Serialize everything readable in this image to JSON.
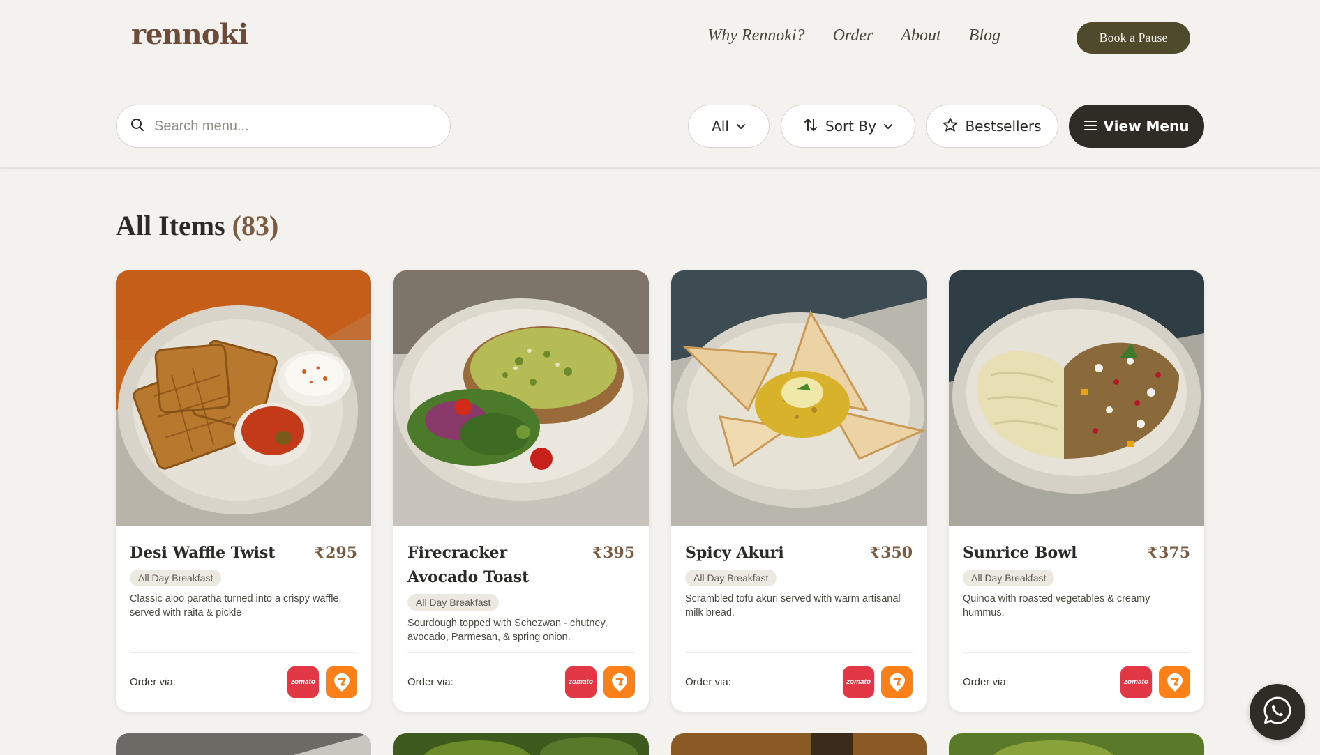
{
  "brand": {
    "logo_text": "rennoki"
  },
  "nav": {
    "items": [
      {
        "label": "Why Rennoki?"
      },
      {
        "label": "Order"
      },
      {
        "label": "About"
      },
      {
        "label": "Blog"
      }
    ],
    "cta_label": "Book a Pause"
  },
  "toolbar": {
    "search_placeholder": "Search menu...",
    "filter_all_label": "All",
    "sort_label": "Sort By",
    "bestsellers_label": "Bestsellers",
    "view_menu_label": "View Menu"
  },
  "section": {
    "title": "All Items",
    "count": "(83)"
  },
  "items": [
    {
      "name": "Desi Waffle Twist",
      "price": "₹295",
      "tag": "All Day Breakfast",
      "description": "Classic aloo paratha turned into a crispy waffle, served with raita & pickle",
      "order_label": "Order via:"
    },
    {
      "name": "Firecracker Avocado Toast",
      "price": "₹395",
      "tag": "All Day Breakfast",
      "description": "Sourdough topped with Schezwan - chutney, avocado, Parmesan, & spring onion.",
      "order_label": "Order via:"
    },
    {
      "name": "Spicy Akuri",
      "price": "₹350",
      "tag": "All Day Breakfast",
      "description": "Scrambled tofu akuri served with warm artisanal milk bread.",
      "order_label": "Order via:"
    },
    {
      "name": "Sunrice Bowl",
      "price": "₹375",
      "tag": "All Day Breakfast",
      "description": "Quinoa with roasted vegetables & creamy hummus.",
      "order_label": "Order via:"
    }
  ],
  "delivery": {
    "zomato_text": "zomato"
  },
  "colors": {
    "brand_dark": "#4f4a2c",
    "accent_brown": "#7a5c44",
    "zomato_red": "#e23744",
    "swiggy_orange": "#fc8019"
  }
}
